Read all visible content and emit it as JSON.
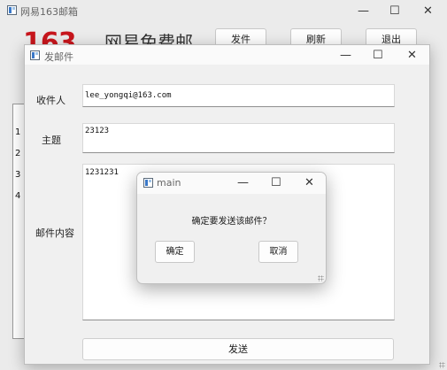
{
  "main_window": {
    "title": "网易163邮箱",
    "buttons": {
      "compose": "发件",
      "refresh": "刷新",
      "logout": "退出"
    },
    "logo": {
      "number": "163",
      "text": "网易免费邮"
    },
    "row_numbers": [
      "1",
      "2",
      "3",
      "4"
    ]
  },
  "compose_window": {
    "title": "发邮件",
    "recipient_label": "收件人",
    "recipient_value": "lee_yongqi@163.com",
    "subject_label": "主题",
    "subject_value": "23123",
    "body_label": "邮件内容",
    "body_value": "1231231",
    "send_label": "发送"
  },
  "dialog": {
    "title": "main",
    "message": "确定要发送该邮件？",
    "ok_label": "确定",
    "cancel_label": "取消"
  },
  "window_controls": {
    "minimize": "—",
    "maximize": "☐",
    "close": "✕"
  },
  "colors": {
    "logo_red": "#c8161d"
  }
}
